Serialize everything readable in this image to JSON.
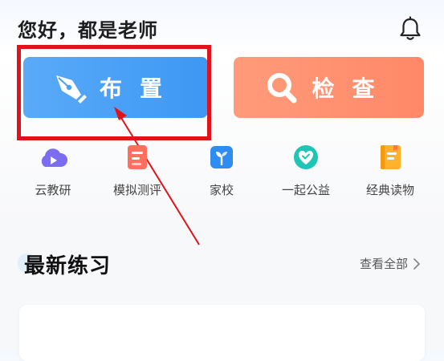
{
  "header": {
    "greeting": "您好，都是老师"
  },
  "actions": {
    "assign_label": "布置",
    "check_label": "检查"
  },
  "shortcuts": [
    {
      "label": "云教研",
      "icon": "cloud-play-icon",
      "color": "#7c6cf2"
    },
    {
      "label": "模拟测评",
      "icon": "document-icon",
      "color": "#ff6f5e"
    },
    {
      "label": "家校",
      "icon": "sprout-icon",
      "color": "#2f8cf0"
    },
    {
      "label": "一起公益",
      "icon": "heart-icon",
      "color": "#1fc6b6"
    },
    {
      "label": "经典读物",
      "icon": "book-icon",
      "color": "#ffb22a"
    }
  ],
  "section": {
    "title": "最新练习",
    "view_all": "查看全部"
  },
  "colors": {
    "assign_bg": "#4aa0f6",
    "check_bg": "#ff9070",
    "annotation_red": "#e0131b"
  }
}
